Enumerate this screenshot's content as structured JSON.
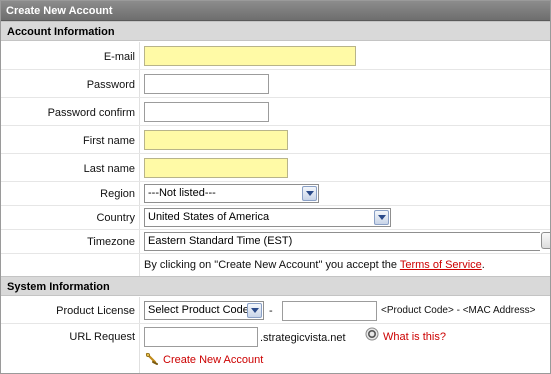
{
  "window": {
    "title": "Create New Account"
  },
  "sections": {
    "account": "Account Information",
    "system": "System Information"
  },
  "fields": {
    "email": {
      "label": "E-mail",
      "value": ""
    },
    "password": {
      "label": "Password",
      "value": ""
    },
    "password_confirm": {
      "label": "Password confirm",
      "value": ""
    },
    "first_name": {
      "label": "First name",
      "value": ""
    },
    "last_name": {
      "label": "Last name",
      "value": ""
    },
    "region": {
      "label": "Region",
      "selected": "---Not listed---"
    },
    "country": {
      "label": "Country",
      "selected": "United States of America"
    },
    "timezone": {
      "label": "Timezone",
      "selected": "Eastern Standard Time (EST)"
    }
  },
  "terms": {
    "prefix": "By clicking on \"Create New Account\" you accept the ",
    "link": "Terms of Service",
    "suffix": "."
  },
  "system": {
    "product_license": {
      "label": "Product License",
      "selected": "Select Product Code",
      "dash": "-",
      "mac_value": "",
      "hint": "<Product Code> - <MAC Address>"
    },
    "url_request": {
      "label": "URL Request",
      "value": "",
      "domain_suffix": ".strategicvista.net",
      "help_link": "What is this?"
    }
  },
  "actions": {
    "create_account": "Create New Account"
  },
  "colors": {
    "required_field": "#fffaa6",
    "link": "#cc0000",
    "title_bar": "#7a7a7a",
    "section_header": "#d9d9d9"
  },
  "icons": {
    "create_account": "key-icon",
    "help": "help-circle-icon",
    "dropdown": "chevron-down-icon"
  }
}
